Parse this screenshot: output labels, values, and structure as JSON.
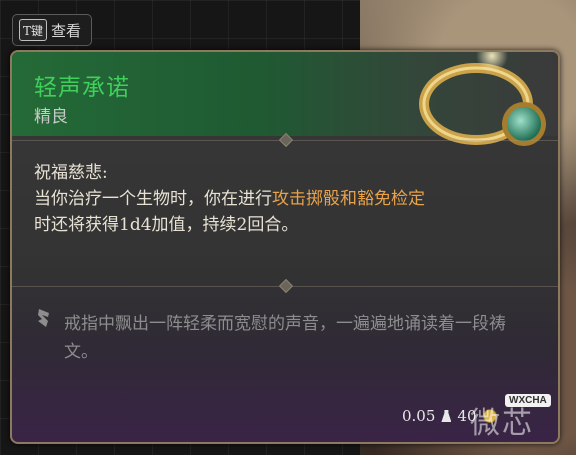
{
  "chip": {
    "key": "T键",
    "label": "查看"
  },
  "item": {
    "name": "轻声承诺",
    "rarity": "精良",
    "effect_title": "祝福慈悲:",
    "effect_pre": "当你治疗一个生物时，你在进行",
    "effect_hl": "攻击掷骰和豁免检定",
    "effect_post": "时还将获得1d4加值，持续2回合。",
    "flavor": "戒指中飘出一阵轻柔而宽慰的声音，一遍遍地诵读着一段祷文。",
    "weight": "0.05",
    "price": "40"
  },
  "colors": {
    "name": "#3fcf5a",
    "highlight": "#e8a24a",
    "border": "#8d7a5e"
  },
  "icons": [
    "key-icon",
    "ring-icon",
    "quill-icon",
    "weight-icon",
    "coin-icon"
  ],
  "watermark": {
    "badge": "WXCHA",
    "text": "微芯"
  }
}
